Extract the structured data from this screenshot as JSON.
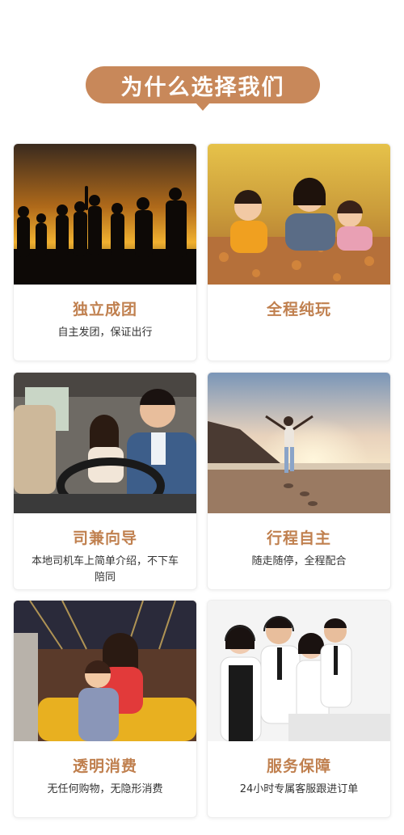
{
  "header": {
    "title": "为什么选择我们"
  },
  "colors": {
    "accent": "#c8885a",
    "title_text": "#c0804f"
  },
  "features": [
    {
      "title": "独立成团",
      "desc": "自主发团，保证出行",
      "image": "group-silhouette-sunset"
    },
    {
      "title": "全程纯玩",
      "desc": "",
      "image": "family-lying-in-autumn-leaves"
    },
    {
      "title": "司兼向导",
      "desc": "本地司机车上简单介绍，不下车陪同",
      "image": "driver-in-car"
    },
    {
      "title": "行程自主",
      "desc": "随走随停，全程配合",
      "image": "person-on-beach-sunrise"
    },
    {
      "title": "透明消费",
      "desc": "无任何购物，无隐形消费",
      "image": "mother-daughter-on-ride"
    },
    {
      "title": "服务保障",
      "desc": "24小时专属客服跟进订单",
      "image": "customer-service-team"
    }
  ]
}
